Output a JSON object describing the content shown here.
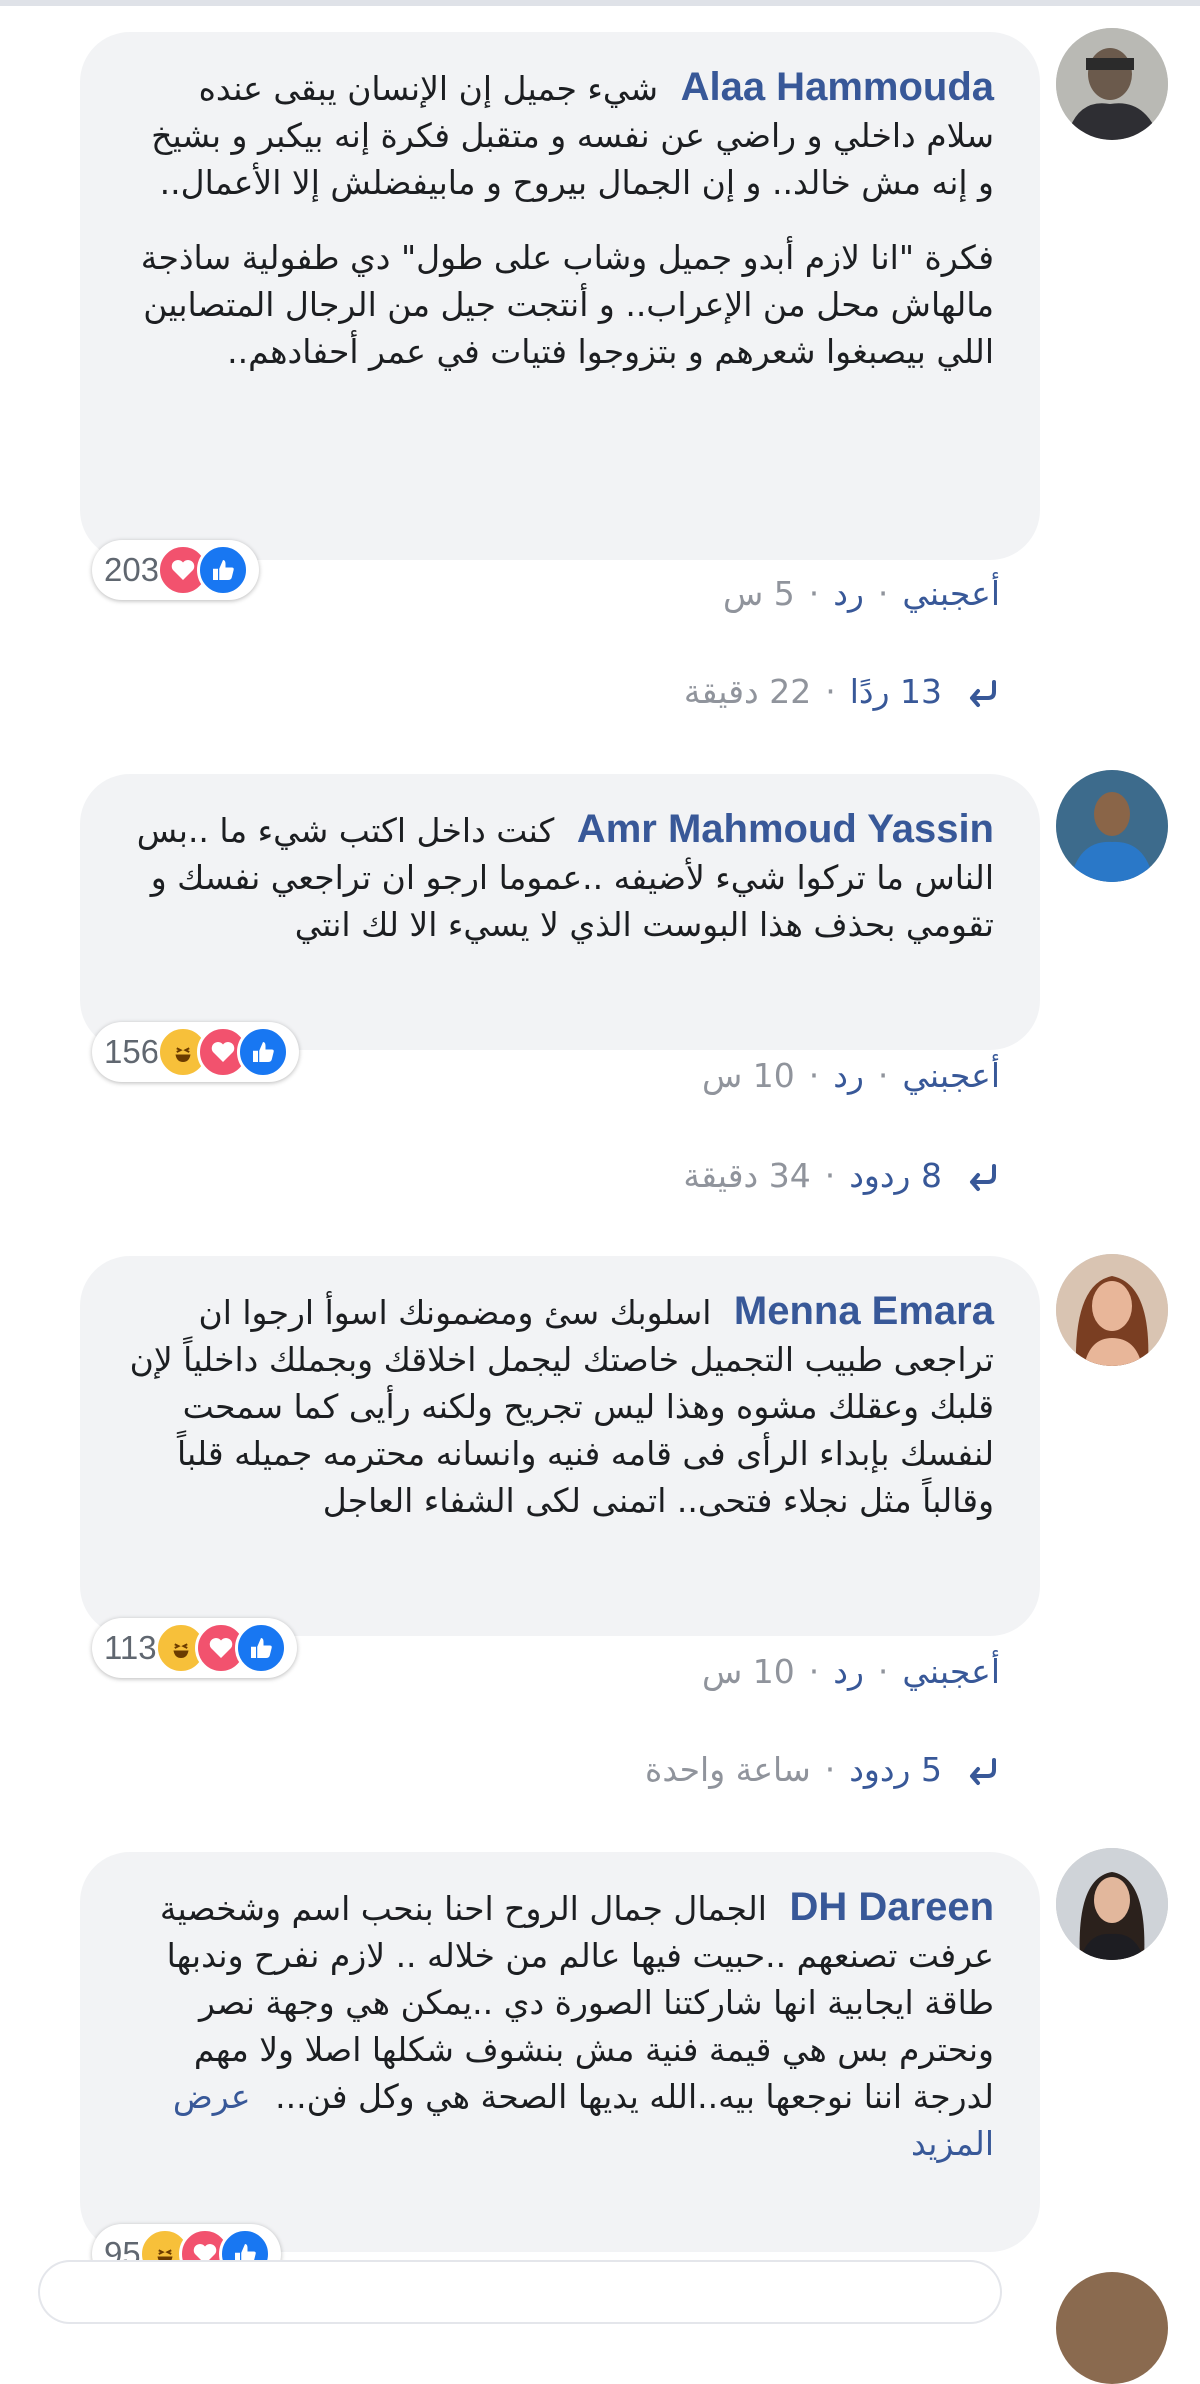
{
  "comments": [
    {
      "author": "Alaa Hammouda",
      "text1": "شيء جميل إن الإنسان يبقى عنده سلام داخلي و راضي عن نفسه و متقبل فكرة إنه بيكبر و بشيخ و إنه مش خالد.. و إن الجمال بيروح و مابيفضلش إلا الأعمال..",
      "text2": "فكرة \"انا لازم أبدو جميل وشاب على طول\" دي طفولية ساذجة مالهاش محل من الإعراب.. و أنتجت جيل من الرجال المتصابين اللي بيصبغوا شعرهم و بتزوجوا فتيات في عمر أحفادهم..",
      "reaction_count": "203",
      "reactions": [
        "love",
        "like"
      ],
      "like_label": "أعجبني",
      "reply_label": "رد",
      "time": "5 س",
      "replies_label": "13 ردًا",
      "replies_time": "22 دقيقة"
    },
    {
      "author": "Amr Mahmoud Yassin",
      "text1": "كنت داخل اكتب شيء ما ..بس الناس ما تركوا شيء لأضيفه ..عموما ارجو ان تراجعي نفسك و تقومي بحذف هذا البوست الذي لا يسيء الا لك انتي",
      "reaction_count": "156",
      "reactions": [
        "haha",
        "love",
        "like"
      ],
      "like_label": "أعجبني",
      "reply_label": "رد",
      "time": "10 س",
      "replies_label": "8 ردود",
      "replies_time": "34 دقيقة"
    },
    {
      "author": "Menna Emara",
      "text1": "اسلوبك سئ ومضمونك اسوأ ارجوا ان تراجعى طبيب التجميل خاصتك ليجمل اخلاقك وبجملك داخلياً لإن قلبك وعقلك مشوه وهذا ليس تجريح ولكنه رأيى كما سمحت لنفسك بإبداء الرأى فى قامه فنيه وانسانه محترمه جميله قلباً وقالباً مثل نجلاء فتحى.. اتمنى لكى الشفاء العاجل",
      "reaction_count": "113",
      "reactions": [
        "haha",
        "love",
        "like"
      ],
      "like_label": "أعجبني",
      "reply_label": "رد",
      "time": "10 س",
      "replies_label": "5 ردود",
      "replies_time": "ساعة واحدة"
    },
    {
      "author": "DH Dareen",
      "text1": "الجمال جمال الروح احنا بنحب اسم وشخصية عرفت تصنعهم ..حبيت فيها عالم من خلاله .. لازم نفرح وندبها طاقة ايجابية انها شاركتنا الصورة دي ..يمكن هي وجهة نصر ونحترم بس هي قيمة فنية مش بنشوف شكلها اصلا ولا مهم لدرجة اننا نوجعها بيه..الله يديها الصحة هي وكل فن...",
      "see_more": "عرض المزيد",
      "reaction_count": "95",
      "reactions": [
        "haha",
        "love",
        "like"
      ]
    }
  ],
  "colors": {
    "link": "#385898",
    "bubble": "#f2f3f5",
    "like": "#1877f2",
    "love": "#f2526e",
    "haha": "#f7c03a",
    "muted": "#90949c"
  }
}
